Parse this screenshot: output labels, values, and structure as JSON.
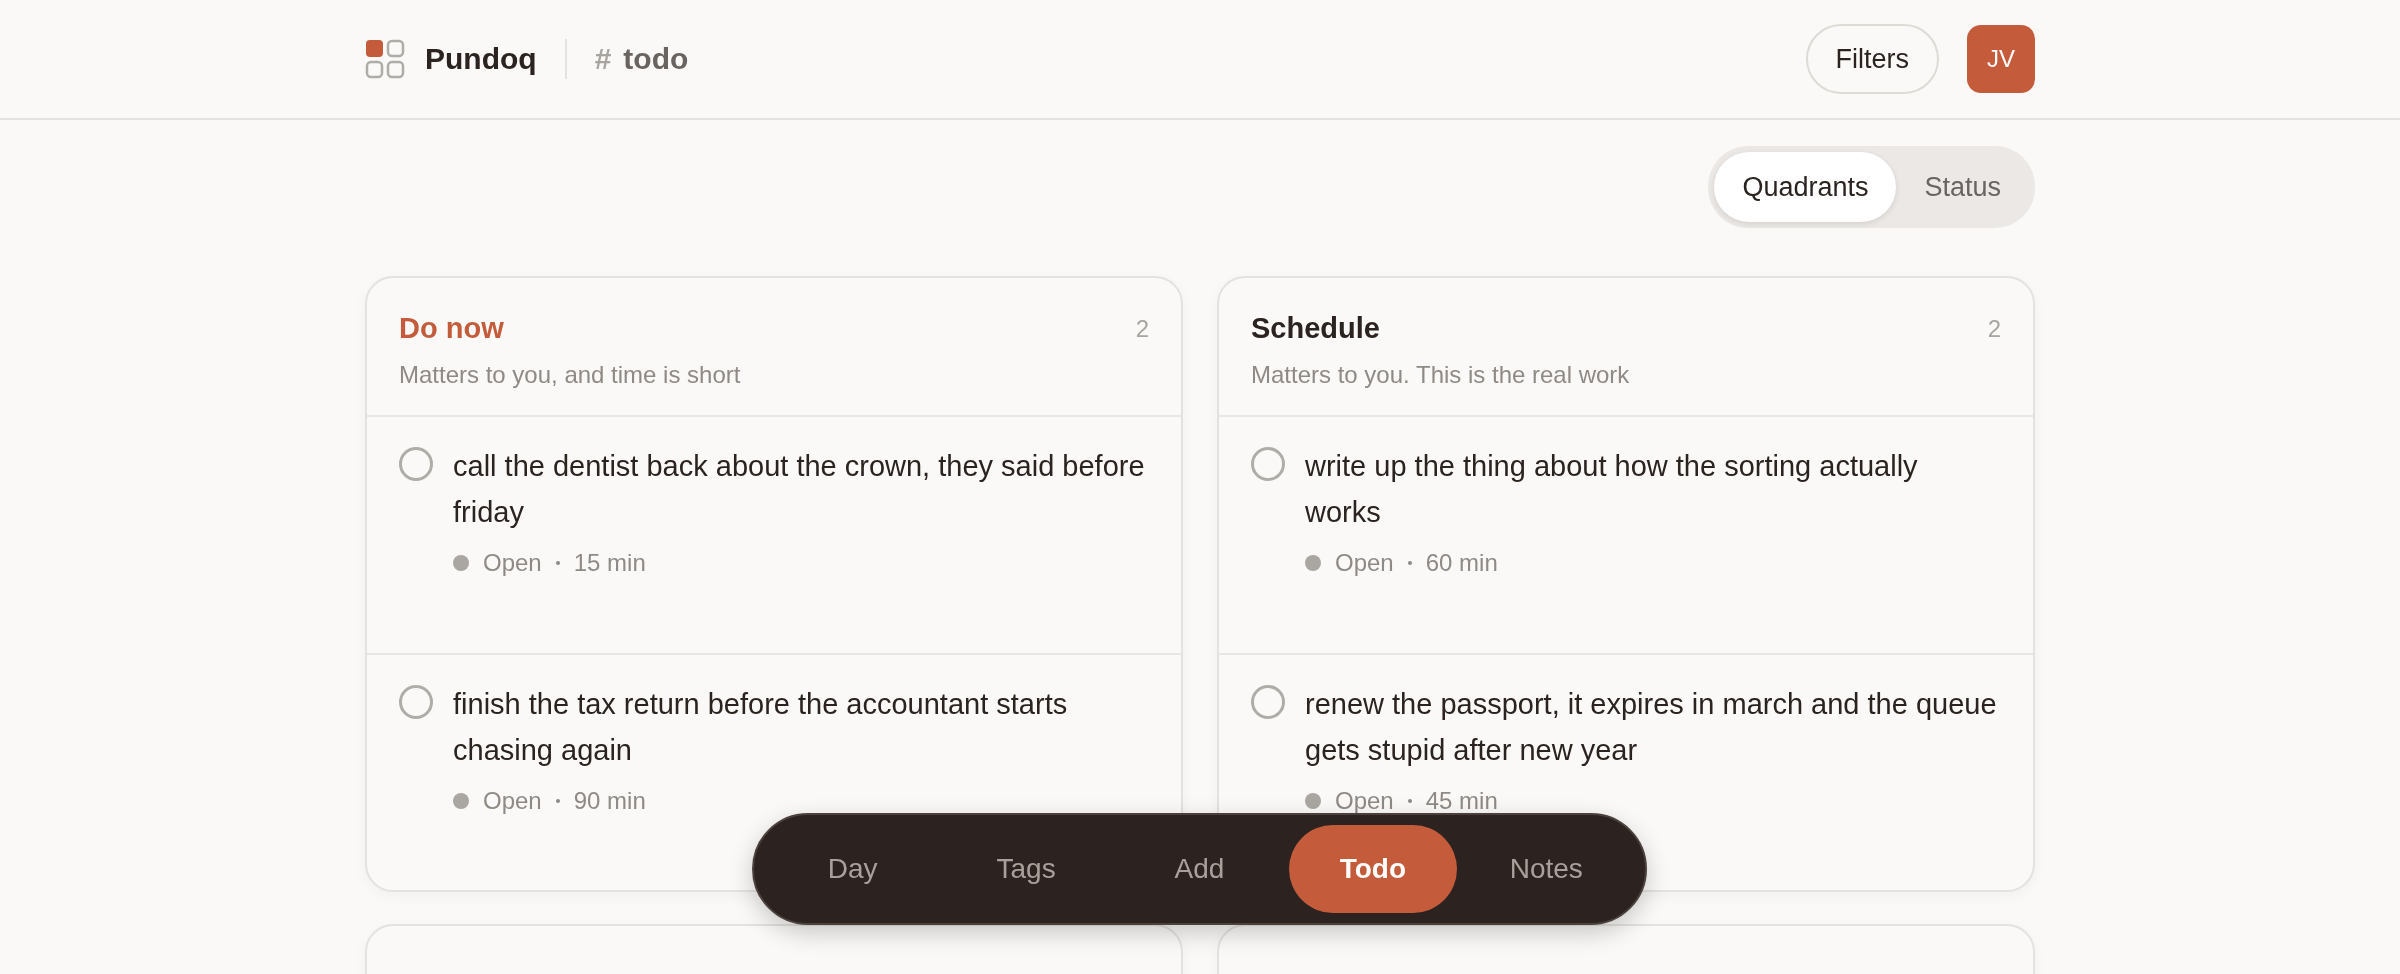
{
  "header": {
    "app_name": "Pundoq",
    "channel_hash": "#",
    "channel": "todo",
    "filters_button": "Filters",
    "avatar": "JV"
  },
  "view_toggle": [
    {
      "label": "Quadrants",
      "selected": true
    },
    {
      "label": "Status",
      "selected": false
    }
  ],
  "quadrants": [
    {
      "title": "Do now",
      "color": "#c45c3c",
      "count": "2",
      "subtitle": "Matters to you, and time is short",
      "tasks": [
        {
          "text": "call the dentist back about the crown, they said before friday",
          "status": "Open",
          "duration": "15 min",
          "done": false
        },
        {
          "text": "finish the tax return before the accountant starts chasing again",
          "status": "Open",
          "duration": "90 min",
          "done": false
        }
      ]
    },
    {
      "title": "Schedule",
      "color": "#2b2320",
      "count": "2",
      "subtitle": "Matters to you. This is the real work",
      "tasks": [
        {
          "text": "write up the thing about how the sorting actually works",
          "status": "Open",
          "duration": "60 min",
          "done": false
        },
        {
          "text": "renew the passport, it expires in march and the queue gets stupid after new year",
          "status": "Open",
          "duration": "45 min",
          "done": false
        }
      ]
    },
    {
      "kind": "empty"
    },
    {
      "kind": "empty"
    }
  ],
  "bottom_nav": [
    {
      "label": "Day",
      "selected": false
    },
    {
      "label": "Tags",
      "selected": false
    },
    {
      "label": "Add",
      "selected": false
    },
    {
      "label": "Todo",
      "selected": true
    },
    {
      "label": "Notes",
      "selected": false
    }
  ]
}
